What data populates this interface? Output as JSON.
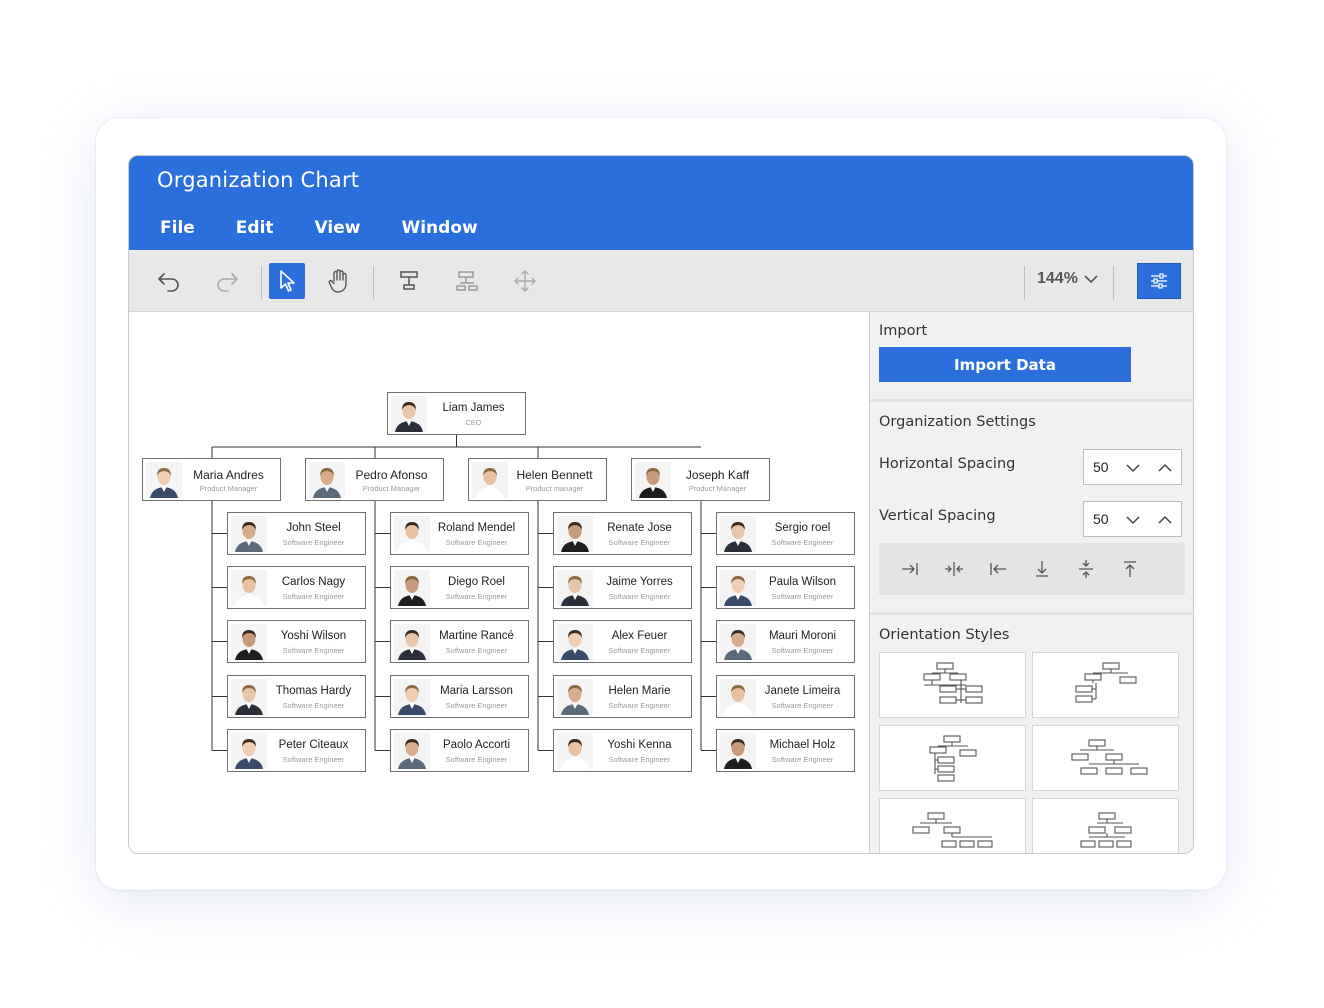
{
  "app": {
    "title": "Organization Chart"
  },
  "menu": [
    {
      "label": "File"
    },
    {
      "label": "Edit"
    },
    {
      "label": "View"
    },
    {
      "label": "Window"
    }
  ],
  "toolbar": {
    "tools": [
      "undo-icon",
      "redo-icon",
      "select-pointer-icon",
      "pan-hand-icon",
      "add-child-icon",
      "add-sibling-icon",
      "move-icon"
    ],
    "active_tool": "select-pointer-icon",
    "zoom": "144%",
    "accent": "#2b6fdc"
  },
  "panel": {
    "import_label": "Import",
    "import_button": "Import Data",
    "org_settings_label": "Organization Settings",
    "horizontal_spacing_label": "Horizontal Spacing",
    "horizontal_spacing_value": "50",
    "vertical_spacing_label": "Vertical Spacing",
    "vertical_spacing_value": "50",
    "orientation_label": "Orientation Styles",
    "alignment_icons": [
      "align-right-icon",
      "align-center-horizontal-icon",
      "align-left-icon",
      "align-bottom-icon",
      "align-center-vertical-icon",
      "align-top-icon"
    ]
  },
  "org": {
    "ceo": {
      "name": "Liam James",
      "role": "CEO"
    },
    "managers": [
      {
        "name": "Maria Andres",
        "role": "Product Manager",
        "reports": [
          {
            "name": "John Steel",
            "role": "Software Engineer"
          },
          {
            "name": "Carlos Nagy",
            "role": "Software Engineer"
          },
          {
            "name": "Yoshi Wilson",
            "role": "Software Engineer"
          },
          {
            "name": "Thomas Hardy",
            "role": "Software Engineer"
          },
          {
            "name": "Peter Citeaux",
            "role": "Software Engineer"
          }
        ]
      },
      {
        "name": "Pedro Afonso",
        "role": "Product Manager",
        "reports": [
          {
            "name": "Roland Mendel",
            "role": "Software Engineer"
          },
          {
            "name": "Diego Roel",
            "role": "Software Engineer"
          },
          {
            "name": "Martine Rancé",
            "role": "Software Engineer"
          },
          {
            "name": "Maria Larsson",
            "role": "Software Engineer"
          },
          {
            "name": "Paolo Accorti",
            "role": "Software Engineer"
          }
        ]
      },
      {
        "name": "Helen Bennett",
        "role": "Product manager",
        "reports": [
          {
            "name": "Renate Jose",
            "role": "Software Engineer"
          },
          {
            "name": "Jaime Yorres",
            "role": "Software Engineer"
          },
          {
            "name": "Alex Feuer",
            "role": "Software Engineer"
          },
          {
            "name": "Helen Marie",
            "role": "Software Engineer"
          },
          {
            "name": "Yoshi Kenna",
            "role": "Software Engineer"
          }
        ]
      },
      {
        "name": "Joseph Kaff",
        "role": "Product Manager",
        "reports": [
          {
            "name": "Sergio roel",
            "role": "Software Engineer"
          },
          {
            "name": "Paula Wilson",
            "role": "Software Engineer"
          },
          {
            "name": "Mauri Moroni",
            "role": "Software Engineer"
          },
          {
            "name": "Janete Limeira",
            "role": "Software Engineer"
          },
          {
            "name": "Michael Holz",
            "role": "Software Engineer"
          }
        ]
      }
    ]
  }
}
